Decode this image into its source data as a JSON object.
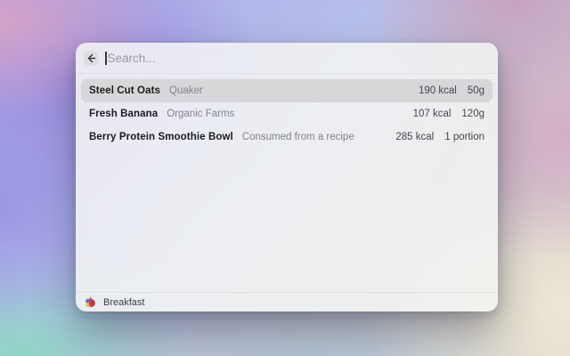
{
  "search": {
    "placeholder": "Search...",
    "back_icon": "arrow-left"
  },
  "results": [
    {
      "name": "Steel Cut Oats",
      "subtitle": "Quaker",
      "calories": "190 kcal",
      "amount": "50g",
      "selected": true
    },
    {
      "name": "Fresh Banana",
      "subtitle": "Organic Farms",
      "calories": "107 kcal",
      "amount": "120g",
      "selected": false
    },
    {
      "name": "Berry Protein Smoothie Bowl",
      "subtitle": "Consumed from a recipe",
      "calories": "285 kcal",
      "amount": "1 portion",
      "selected": false
    }
  ],
  "footer": {
    "label": "Breakfast",
    "icon": "app-logo-icon"
  },
  "colors": {
    "row_highlight": "#d7d7da",
    "window_background": "#f3f4f3",
    "placeholder_text": "#9b9ba2",
    "primary_text": "#1c1c1e",
    "secondary_text": "#83838a"
  }
}
